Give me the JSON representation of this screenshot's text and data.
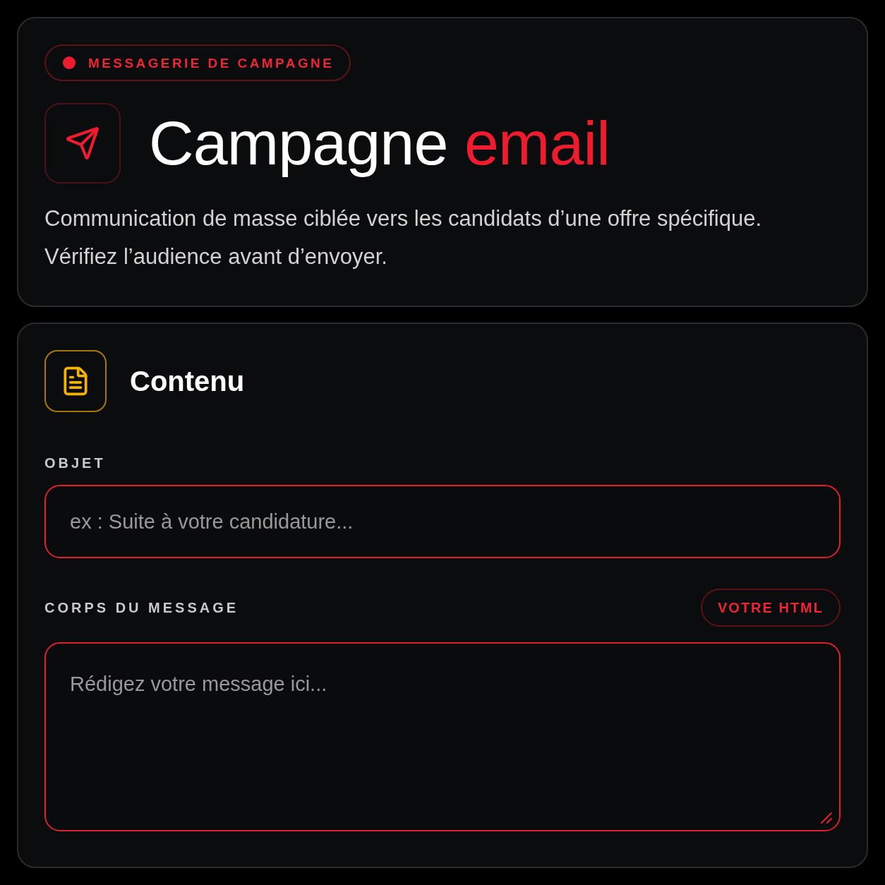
{
  "header": {
    "badge": {
      "label": "MESSAGERIE DE CAMPAGNE"
    },
    "title": {
      "text": "Campagne",
      "accent": "email"
    },
    "description": "Communication de masse ciblée vers les candidats d’une offre spécifique. Vérifiez l’audience avant d’envoyer."
  },
  "content": {
    "title": "Contenu",
    "fields": [
      {
        "kind": "input",
        "label": "OBJET",
        "placeholder": "ex : Suite à votre candidature..."
      },
      {
        "kind": "textarea",
        "label": "CORPS DU MESSAGE",
        "action": "VOTRE HTML",
        "placeholder": "Rédigez votre message ici..."
      }
    ]
  }
}
